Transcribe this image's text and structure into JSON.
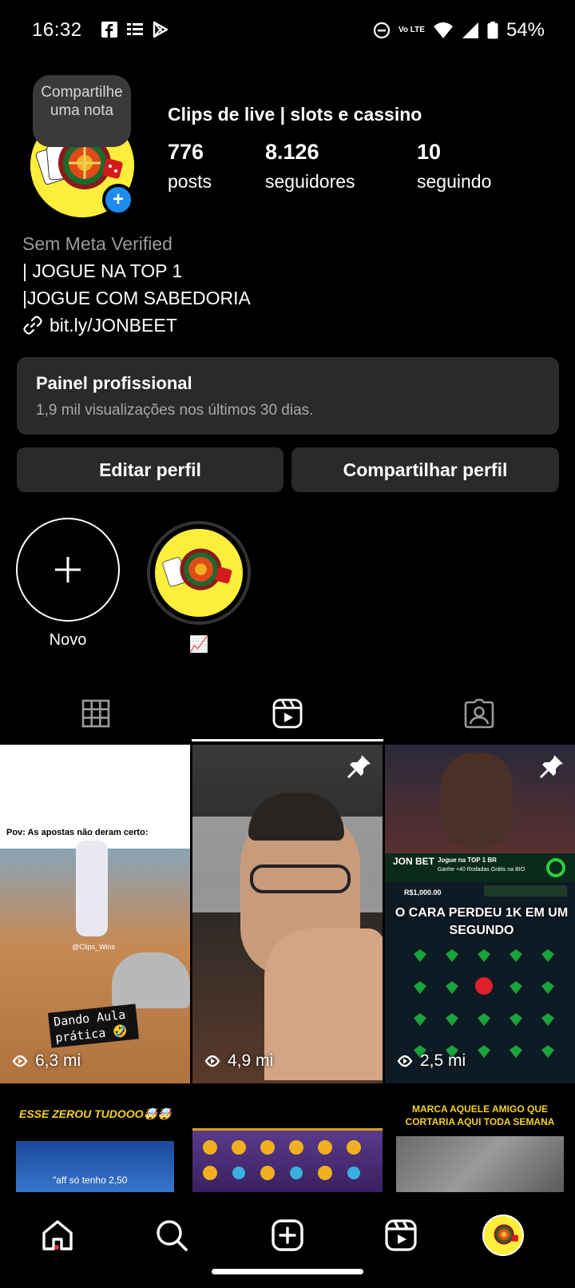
{
  "status_bar": {
    "time": "16:32",
    "battery": "54%",
    "network": "Vo LTE",
    "app_icons": [
      "facebook-icon",
      "news-icon",
      "play-store-icon"
    ]
  },
  "profile": {
    "note_bubble": "Compartilhe uma nota",
    "name": "Clips de live | slots e cassino",
    "stats": [
      {
        "value": "776",
        "label": "posts"
      },
      {
        "value": "8.126",
        "label": "seguidores"
      },
      {
        "value": "10",
        "label": "seguindo"
      }
    ],
    "bio": {
      "category": "Sem Meta Verified",
      "line1": "| JOGUE NA TOP 1",
      "line2": "|JOGUE COM SABEDORIA",
      "link": "bit.ly/JONBEET"
    }
  },
  "pro_panel": {
    "title": "Painel profissional",
    "subtitle": "1,9 mil visualizações nos últimos 30 dias."
  },
  "buttons": {
    "edit": "Editar perfil",
    "share": "Compartilhar perfil"
  },
  "highlights": {
    "new_label": "Novo",
    "item_label": "📈"
  },
  "tabs": [
    "grid-icon",
    "reels-icon",
    "tagged-icon"
  ],
  "active_tab": "reels-icon",
  "reels": [
    {
      "views": "6,3 mi",
      "caption": "Pov: As apostas não deram certo:",
      "overlay": "Dando Aula prática 🤣",
      "watermark": "@Clips_Wins",
      "pinned": true
    },
    {
      "views": "4,9 mi",
      "pinned": true
    },
    {
      "views": "2,5 mi",
      "caption": "O CARA PERDEU 1K EM UM SEGUNDO",
      "banner_title": "Jogue na TOP 1 BR",
      "banner_sub": "Ganhe +40 Rodadas Grátis na BIO",
      "brand": "JON BET",
      "balance": "R$1,000.00",
      "pinned": true
    },
    {
      "caption": "ESSE ZEROU TUDOOO🤯🤯",
      "subcaption": "\"aff só tenho 2,50"
    },
    {},
    {
      "caption": "MARCA AQUELE AMIGO QUE CORTARIA AQUI TODA SEMANA"
    }
  ],
  "colors": {
    "background": "#000000",
    "panel": "#2a2a2d",
    "accent_blue": "#1d8cf0",
    "avatar_yellow": "#fcee3a",
    "notification_red": "#ff3040"
  }
}
